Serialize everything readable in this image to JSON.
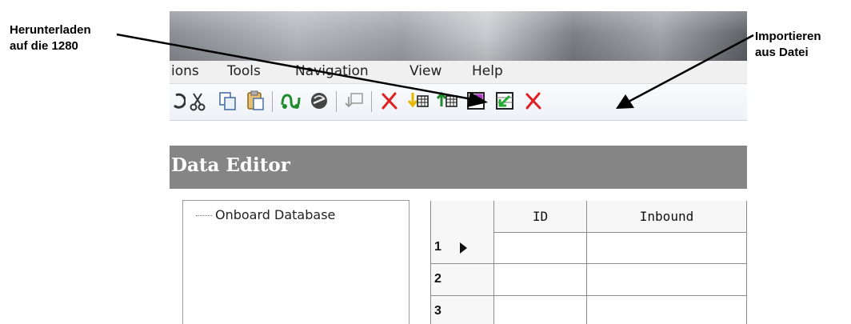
{
  "annotations": {
    "left": {
      "line1": "Herunterladen",
      "line2": "auf die 1280"
    },
    "right": {
      "line1": "Importieren",
      "line2": "aus Datei"
    }
  },
  "menu": {
    "items": [
      "ions",
      "Tools",
      "Navigation",
      "View",
      "Help"
    ]
  },
  "toolbar": {
    "buttons": [
      "redo-icon",
      "cut-icon",
      "copy-icon",
      "paste-icon",
      "connect-icon",
      "disconnect-icon",
      "transfer-icon",
      "delete-icon",
      "download-table-icon",
      "upload-table-icon",
      "export-file-icon",
      "import-file-icon",
      "clear-icon"
    ]
  },
  "editor": {
    "title": "Data Editor",
    "tree": {
      "root": "Onboard Database"
    },
    "grid": {
      "columns": [
        "ID",
        "Inbound"
      ],
      "rows": [
        {
          "num": "1",
          "cells": [
            "",
            ""
          ],
          "current": true
        },
        {
          "num": "2",
          "cells": [
            "",
            ""
          ],
          "current": false
        },
        {
          "num": "3",
          "cells": [
            "",
            ""
          ],
          "current": false
        }
      ]
    }
  },
  "colors": {
    "header_bg": "#858585",
    "delete_red": "#e02020",
    "download_arrow": "#e6b800",
    "upload_arrow": "#1f8a2e",
    "export_arrow": "#b23cc8",
    "import_arrow": "#22aa33"
  }
}
